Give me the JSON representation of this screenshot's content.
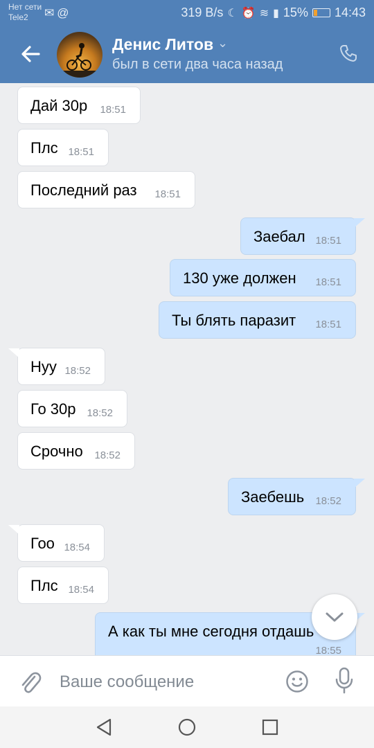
{
  "status_bar": {
    "carrier_line1": "Нет сети",
    "carrier_line2": "Tele2",
    "speed": "319 B/s",
    "battery": "15%",
    "time": "14:43"
  },
  "header": {
    "name": "Денис Литов",
    "status": "был в сети два часа назад"
  },
  "messages": [
    {
      "dir": "in",
      "text": "Дай 30р",
      "time": "18:51"
    },
    {
      "dir": "in",
      "text": "Плс",
      "time": "18:51"
    },
    {
      "dir": "in",
      "text": "Последний раз",
      "time": "18:51"
    },
    {
      "dir": "out",
      "text": "Заебал",
      "time": "18:51"
    },
    {
      "dir": "out",
      "text": "130 уже должен",
      "time": "18:51"
    },
    {
      "dir": "out",
      "text": "Ты блять паразит",
      "time": "18:51"
    },
    {
      "dir": "in",
      "text": "Нуу",
      "time": "18:52"
    },
    {
      "dir": "in",
      "text": "Го 30р",
      "time": "18:52"
    },
    {
      "dir": "in",
      "text": "Срочно",
      "time": "18:52"
    },
    {
      "dir": "out",
      "text": "Заебешь",
      "time": "18:52"
    },
    {
      "dir": "in",
      "text": "Гоо",
      "time": "18:54"
    },
    {
      "dir": "in",
      "text": "Плс",
      "time": "18:54"
    },
    {
      "dir": "out",
      "text": "А как ты мне сегодня отдашь",
      "time": "18:55"
    }
  ],
  "composer": {
    "placeholder": "Ваше сообщение"
  },
  "colors": {
    "brand": "#5181b8",
    "outgoing_bubble": "#cce4ff",
    "incoming_bubble": "#ffffff",
    "background": "#edeef0"
  },
  "icons": [
    "back-arrow-icon",
    "chevron-down-icon",
    "phone-icon",
    "paperclip-icon",
    "smile-icon",
    "microphone-icon",
    "scroll-down-chevron-icon",
    "nav-back-icon",
    "nav-home-icon",
    "nav-recents-icon"
  ]
}
